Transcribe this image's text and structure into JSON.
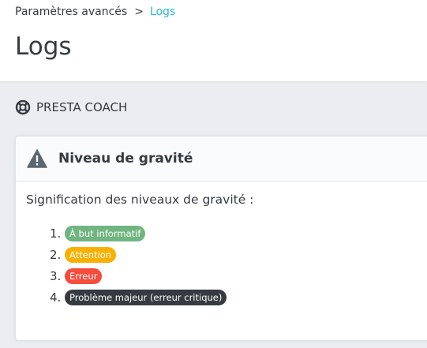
{
  "breadcrumb": {
    "parent": "Paramètres avancés",
    "separator": ">",
    "current": "Logs"
  },
  "page": {
    "title": "Logs"
  },
  "coach": {
    "label": "PRESTA COACH",
    "icon": "lifebuoy-icon"
  },
  "severity_card": {
    "title": "Niveau de gravité",
    "icon": "warning-icon",
    "intro": "Signification des niveaux de gravité :",
    "levels": [
      {
        "num": "1.",
        "label": "À but informatif",
        "color": "#70b580"
      },
      {
        "num": "2.",
        "label": "Attention",
        "color": "#fab000"
      },
      {
        "num": "3.",
        "label": "Erreur",
        "color": "#f54c3e"
      },
      {
        "num": "4.",
        "label": "Problème majeur (erreur critique)",
        "color": "#363a41"
      }
    ]
  },
  "colors": {
    "accent": "#25b9d7",
    "text": "#363a41",
    "background": "#ebedf0"
  }
}
